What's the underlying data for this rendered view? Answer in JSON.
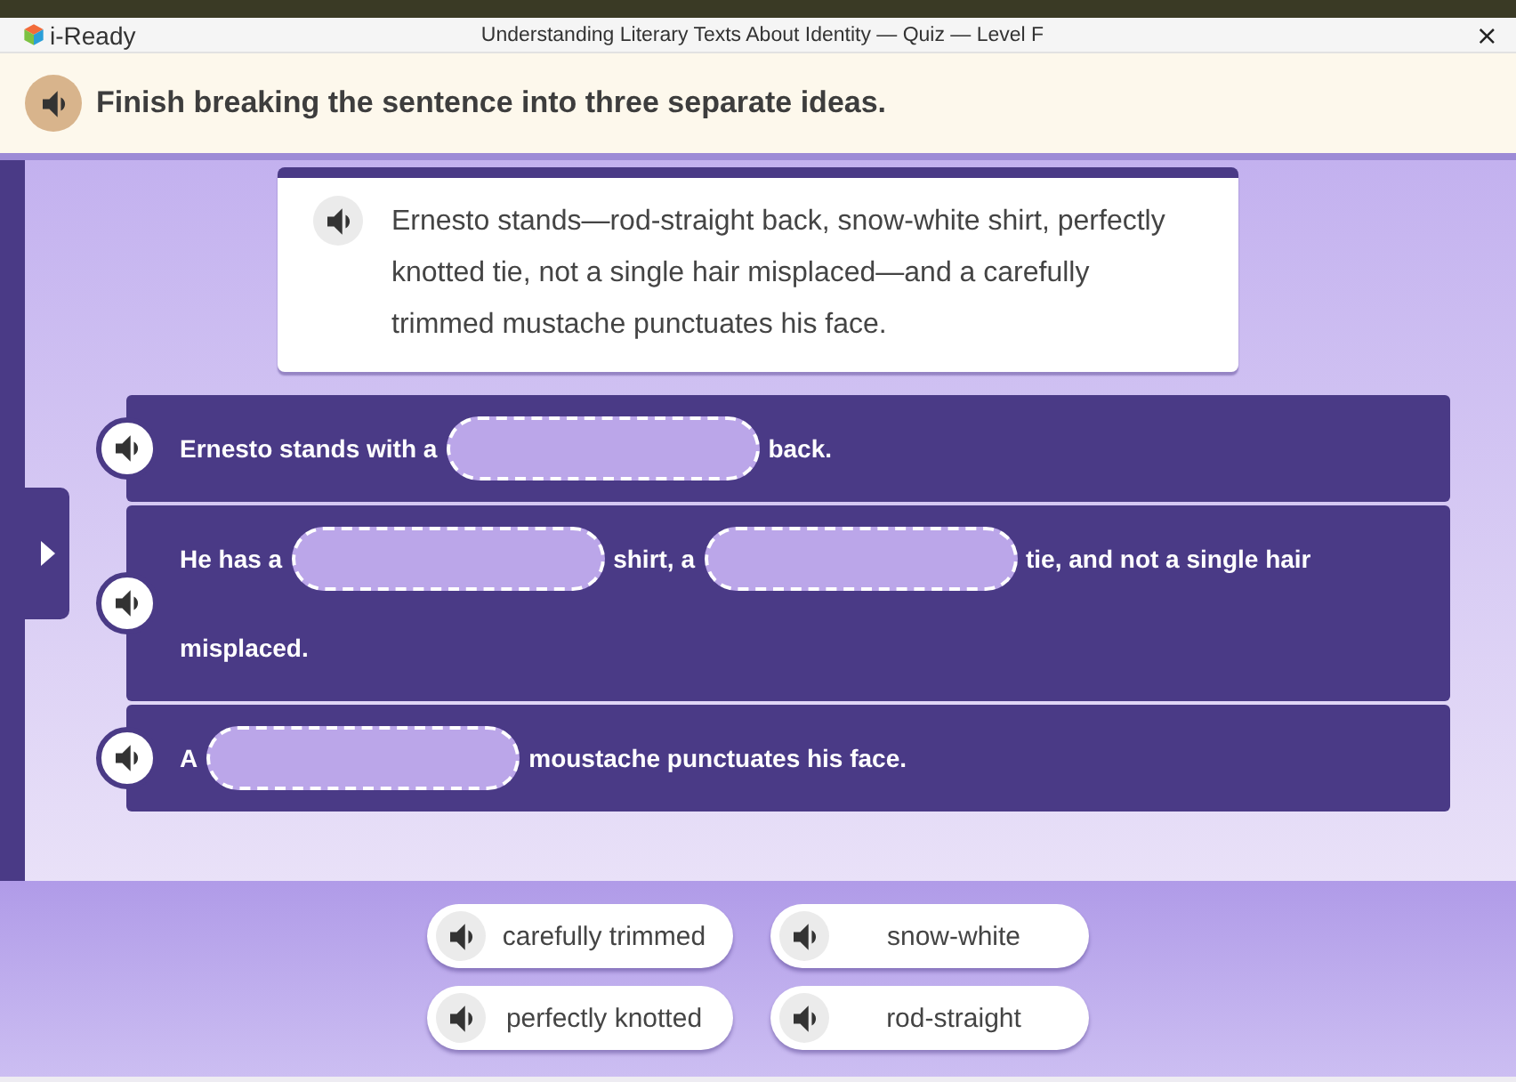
{
  "window": {
    "logo": "i-Ready",
    "title": "Understanding Literary Texts About Identity — Quiz — Level F",
    "close": "×"
  },
  "instruction": {
    "text": "Finish breaking the sentence into three separate ideas."
  },
  "passage": {
    "text": "Ernesto stands—rod-straight back, snow-white shirt, perfectly knotted tie, not a single hair misplaced—and a carefully trimmed mustache punctuates his face."
  },
  "sentences": [
    {
      "parts": [
        {
          "kind": "text",
          "text": "Ernesto stands with a"
        },
        {
          "kind": "blank"
        },
        {
          "kind": "text",
          "text": "back."
        }
      ]
    },
    {
      "parts": [
        {
          "kind": "text",
          "text": "He has a"
        },
        {
          "kind": "blank"
        },
        {
          "kind": "text",
          "text": "shirt, a"
        },
        {
          "kind": "blank"
        },
        {
          "kind": "text",
          "text": "tie, and not a single hair"
        },
        {
          "kind": "text",
          "text": "misplaced."
        }
      ]
    },
    {
      "parts": [
        {
          "kind": "text",
          "text": "A"
        },
        {
          "kind": "blank"
        },
        {
          "kind": "text",
          "text": "moustache punctuates his face."
        }
      ]
    }
  ],
  "word_bank": [
    {
      "text": "carefully trimmed"
    },
    {
      "text": "snow-white"
    },
    {
      "text": "perfectly knotted"
    },
    {
      "text": "rod-straight"
    }
  ]
}
